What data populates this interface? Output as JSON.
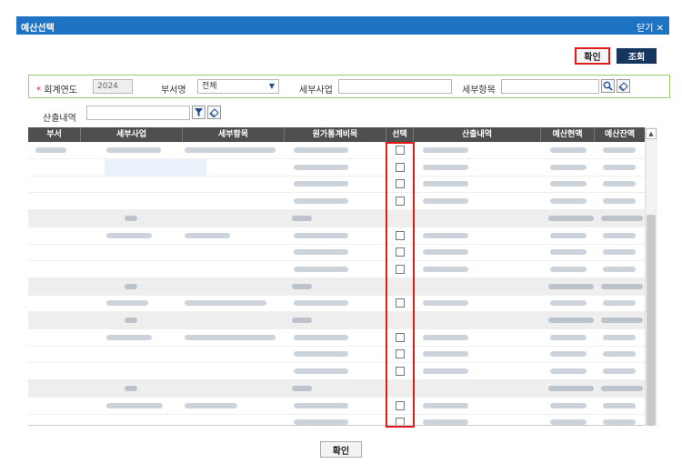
{
  "dialog": {
    "title": "예산선택",
    "close_label": "닫기 ✕"
  },
  "toolbar": {
    "confirm_label": "확인",
    "search_label": "조회"
  },
  "filters": {
    "fiscal_year": {
      "label": "회계연도",
      "required_mark": "*",
      "value": "2024"
    },
    "department": {
      "label": "부서명",
      "value": "전체"
    },
    "sub_project": {
      "label": "세부사업",
      "value": ""
    },
    "sub_item": {
      "label": "세부항목",
      "value": ""
    },
    "calc_detail": {
      "label": "산출내역",
      "value": ""
    }
  },
  "grid": {
    "columns": [
      "부서",
      "세부사업",
      "세부항목",
      "원가통계비목",
      "선택",
      "산출내역",
      "예산현액",
      "예산잔액"
    ],
    "rows": [
      {
        "type": "data",
        "checkbox": true
      },
      {
        "type": "data",
        "checkbox": true
      },
      {
        "type": "data",
        "checkbox": true
      },
      {
        "type": "data",
        "checkbox": true
      },
      {
        "type": "subtotal",
        "checkbox": false
      },
      {
        "type": "data",
        "checkbox": true
      },
      {
        "type": "data",
        "checkbox": true
      },
      {
        "type": "data",
        "checkbox": true
      },
      {
        "type": "subtotal",
        "checkbox": false
      },
      {
        "type": "data",
        "checkbox": true
      },
      {
        "type": "subtotal",
        "checkbox": false
      },
      {
        "type": "data",
        "checkbox": true
      },
      {
        "type": "data",
        "checkbox": true
      },
      {
        "type": "data",
        "checkbox": true
      },
      {
        "type": "subtotal",
        "checkbox": false
      },
      {
        "type": "data",
        "checkbox": true
      },
      {
        "type": "data",
        "checkbox": true
      }
    ]
  },
  "footer": {
    "confirm_label": "확인"
  },
  "colors": {
    "titlebar": "#1f73c4",
    "search_button": "#16365f",
    "highlight": "#e01b1b",
    "filter_border": "#9ccc6a"
  }
}
